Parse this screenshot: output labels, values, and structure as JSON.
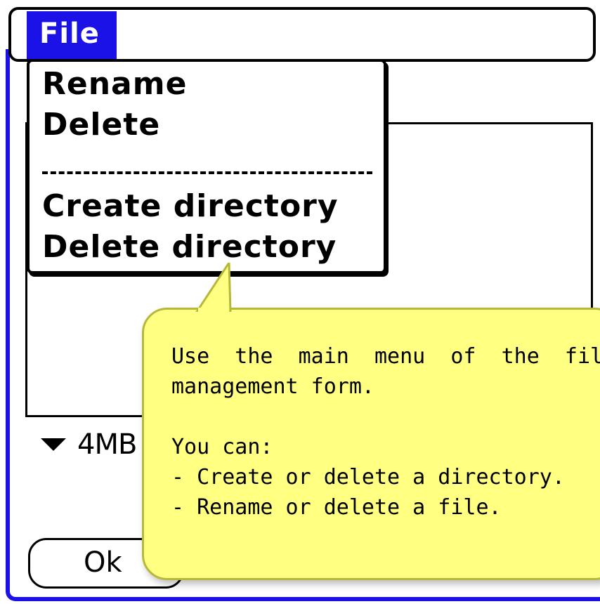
{
  "menu_bar": {
    "title": "File"
  },
  "menu": {
    "items": [
      {
        "label": "Rename"
      },
      {
        "label": "Delete"
      },
      {
        "label": "Create directory"
      },
      {
        "label": "Delete directory"
      }
    ]
  },
  "storage": {
    "label": "4MB"
  },
  "ok_button": {
    "label": "Ok"
  },
  "tooltip": {
    "line1": "Use  the  main  menu  of  the  file",
    "line2": "management form.",
    "line3": "You can:",
    "line4": "- Create or delete a directory.",
    "line5": "- Rename or delete a file."
  },
  "colors": {
    "accent": "#1a12e6",
    "tooltip_bg": "#ffff82"
  },
  "icons": {
    "storage_dropdown": "triangle-down-icon"
  }
}
